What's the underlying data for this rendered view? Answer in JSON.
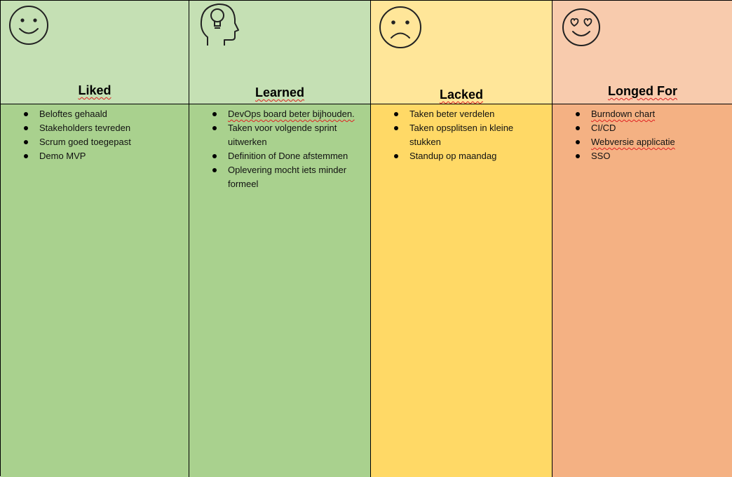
{
  "columns": [
    {
      "title": "Liked",
      "icon": "smiley-face-icon",
      "items": [
        "Beloftes gehaald",
        "Stakeholders tevreden",
        "Scrum goed toegepast",
        "Demo MVP"
      ]
    },
    {
      "title": "Learned",
      "icon": "head-lightbulb-icon",
      "items": [
        "DevOps board beter bijhouden.",
        "Taken voor volgende sprint uitwerken",
        "Definition of Done afstemmen",
        "Oplevering mocht iets minder formeel"
      ]
    },
    {
      "title": "Lacked",
      "icon": "sad-face-icon",
      "items": [
        "Taken beter verdelen",
        "Taken opsplitsen in kleine stukken",
        "Standup op maandag"
      ]
    },
    {
      "title": "Longed For",
      "icon": "heart-eyes-face-icon",
      "items": [
        "Burndown chart",
        "CI/CD",
        "Webversie applicatie",
        "SSO"
      ]
    }
  ],
  "colors": {
    "liked_header": "#c5e0b4",
    "liked_body": "#a9d18e",
    "learned_header": "#c5e0b4",
    "learned_body": "#a9d18e",
    "lacked_header": "#ffe699",
    "lacked_body": "#ffd966",
    "longed_header": "#f8cbad",
    "longed_body": "#f4b183",
    "border": "#000000"
  }
}
